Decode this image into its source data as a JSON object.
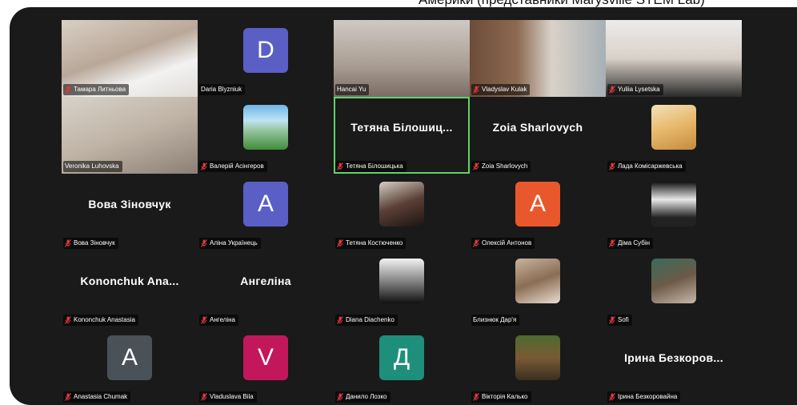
{
  "caption": "Америки (представники Marysville STEM Lab)",
  "colors": {
    "panel": "#1a1a1a",
    "muted_mic": "#e03a3a",
    "active_speaker": "#5fd36b"
  },
  "participants": [
    {
      "name": "Тамара Литньова",
      "type": "video",
      "muted": true
    },
    {
      "name": "Daria Blyzniuk",
      "type": "avatar",
      "initial": "D",
      "color": "#5a5fc6",
      "muted": false
    },
    {
      "name": "Hancai Yu",
      "type": "video",
      "muted": false
    },
    {
      "name": "Vladyslav Kulak",
      "type": "video",
      "muted": true
    },
    {
      "name": "Yuliia Lysetska",
      "type": "video",
      "muted": true
    },
    {
      "name": "Veronika Luhovska",
      "type": "video",
      "muted": false
    },
    {
      "name": "Валерій Асінгеров",
      "type": "photo",
      "muted": true
    },
    {
      "name": "Тетяна Білошицька",
      "type": "text",
      "display": "Тетяна Білошиц...",
      "muted": true,
      "active": true
    },
    {
      "name": "Zoia Sharlovych",
      "type": "text",
      "display": "Zoia Sharlovych",
      "muted": true
    },
    {
      "name": "Лада Комісаржевська",
      "type": "photo",
      "muted": true
    },
    {
      "name": "Вова Зіновчук",
      "type": "text",
      "display": "Вова Зіновчук",
      "muted": true
    },
    {
      "name": "Аліна Українець",
      "type": "avatar",
      "initial": "A",
      "color": "#5a5fc6",
      "muted": true
    },
    {
      "name": "Тетяна Костюченко",
      "type": "photo",
      "muted": true
    },
    {
      "name": "Олексій Антонов",
      "type": "avatar",
      "initial": "A",
      "color": "#e8582c",
      "muted": true
    },
    {
      "name": "Діма Субін",
      "type": "photo",
      "muted": true
    },
    {
      "name": "Kononchuk Anastasia",
      "type": "text",
      "display": "Kononchuk Ana...",
      "muted": true
    },
    {
      "name": "Ангеліна",
      "type": "text",
      "display": "Ангеліна",
      "muted": true
    },
    {
      "name": "Diana Diachenko",
      "type": "photo",
      "muted": true
    },
    {
      "name": "Близнюк Дар'я",
      "type": "photo",
      "muted": false
    },
    {
      "name": "Sofi",
      "type": "photo",
      "muted": true
    },
    {
      "name": "Anastasia Chumak",
      "type": "avatar",
      "initial": "A",
      "color": "#4a5157",
      "muted": true
    },
    {
      "name": "Vladuslava Bila",
      "type": "avatar",
      "initial": "V",
      "color": "#c2185b",
      "muted": true
    },
    {
      "name": "Данило Лозко",
      "type": "avatar",
      "initial": "Д",
      "color": "#1e8f7a",
      "muted": true
    },
    {
      "name": "Вікторія Калько",
      "type": "photo",
      "muted": true
    },
    {
      "name": "Ірина Безкоровайна",
      "type": "text",
      "display": "Ірина Безкоров...",
      "muted": true
    }
  ]
}
